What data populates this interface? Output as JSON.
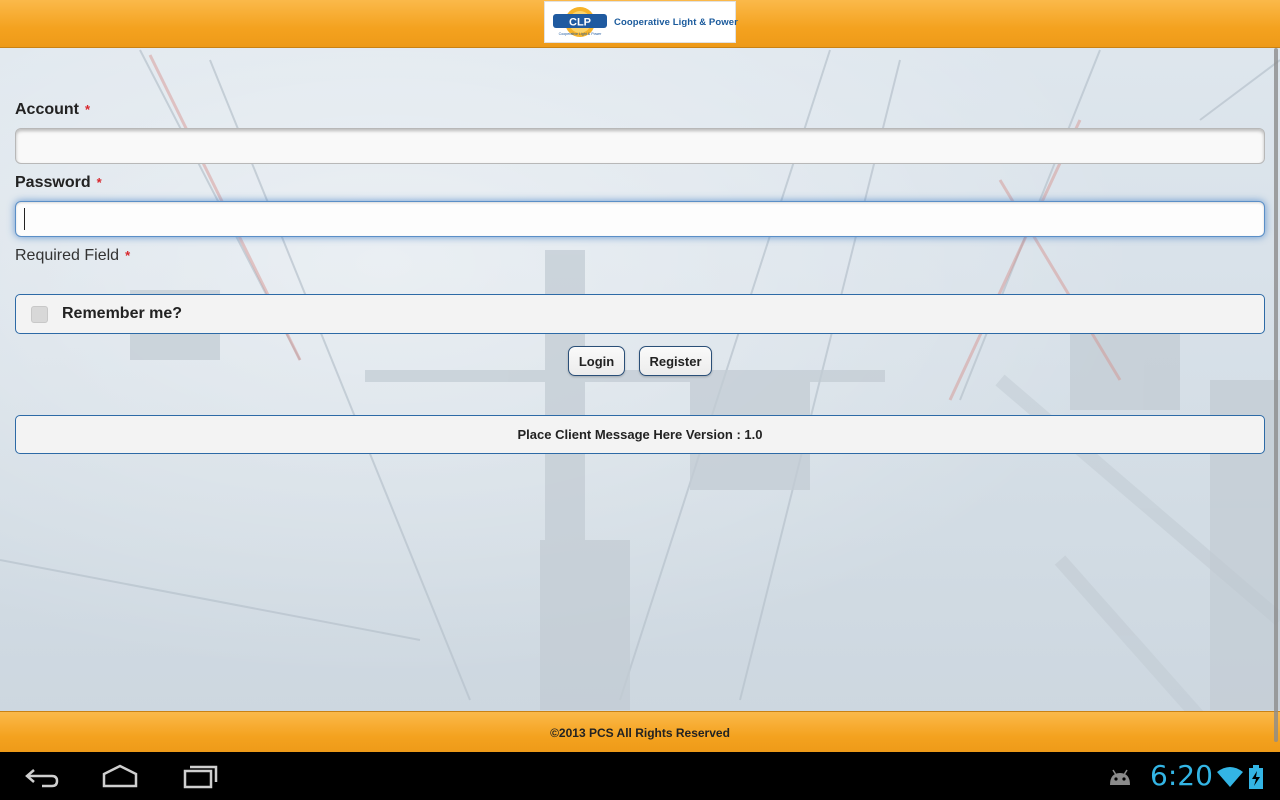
{
  "header": {
    "logo_mark": "CLP",
    "logo_tagline": "Cooperative Light & Power",
    "logo_text": "Cooperative Light & Power"
  },
  "form": {
    "account_label": "Account",
    "account_value": "",
    "password_label": "Password",
    "password_value": "",
    "required_marker": "*",
    "required_note": "Required Field",
    "remember_label": "Remember me?",
    "remember_checked": false
  },
  "buttons": {
    "login": "Login",
    "register": "Register"
  },
  "message": "Place Client Message Here Version : 1.0",
  "footer": {
    "copyright": "©2013 PCS All Rights Reserved"
  },
  "system_bar": {
    "time": "6:20",
    "clock_color": "#33b5e5"
  },
  "colors": {
    "header_accent": "#f4a21f",
    "border_accent": "#2d6aa6",
    "required": "#d8262c"
  }
}
